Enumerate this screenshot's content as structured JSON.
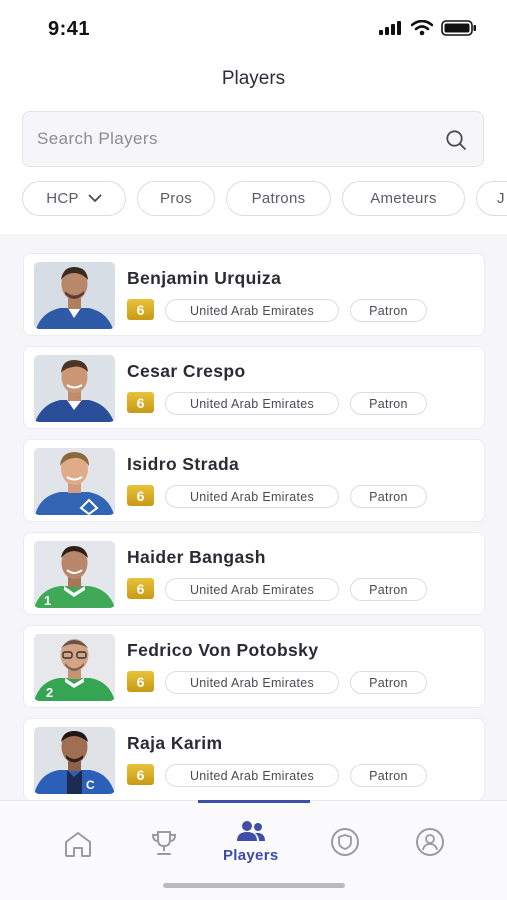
{
  "status_bar": {
    "time": "9:41"
  },
  "header": {
    "title": "Players"
  },
  "search": {
    "placeholder": "Search Players"
  },
  "filters": [
    {
      "label": "HCP",
      "has_dropdown": true
    },
    {
      "label": "Pros"
    },
    {
      "label": "Patrons"
    },
    {
      "label": "Ameteurs"
    },
    {
      "label": "J"
    }
  ],
  "players": [
    {
      "name": "Benjamin Urquiza",
      "handicap": "6",
      "country": "United Arab Emirates",
      "role": "Patron",
      "jersey_color": "#2f5aa8"
    },
    {
      "name": "Cesar Crespo",
      "handicap": "6",
      "country": "United Arab Emirates",
      "role": "Patron",
      "jersey_color": "#2a4f98"
    },
    {
      "name": "Isidro Strada",
      "handicap": "6",
      "country": "United Arab Emirates",
      "role": "Patron",
      "jersey_color": "#3266b5"
    },
    {
      "name": "Haider Bangash",
      "handicap": "6",
      "country": "United Arab Emirates",
      "role": "Patron",
      "jersey_color": "#3fa957"
    },
    {
      "name": "Fedrico Von Potobsky",
      "handicap": "6",
      "country": "United Arab Emirates",
      "role": "Patron",
      "jersey_color": "#35a553"
    },
    {
      "name": "Raja Karim",
      "handicap": "6",
      "country": "United Arab Emirates",
      "role": "Patron",
      "jersey_color": "#2c5fb8"
    }
  ],
  "tab_bar": {
    "tabs": [
      {
        "icon": "home-icon",
        "label": ""
      },
      {
        "icon": "trophy-icon",
        "label": ""
      },
      {
        "icon": "players-icon",
        "label": "Players",
        "active": true
      },
      {
        "icon": "shield-icon",
        "label": ""
      },
      {
        "icon": "profile-icon",
        "label": ""
      }
    ]
  },
  "colors": {
    "accent": "#3f4fa8",
    "badge_gold": "#d9a91f",
    "background": "#f6f6f9"
  }
}
